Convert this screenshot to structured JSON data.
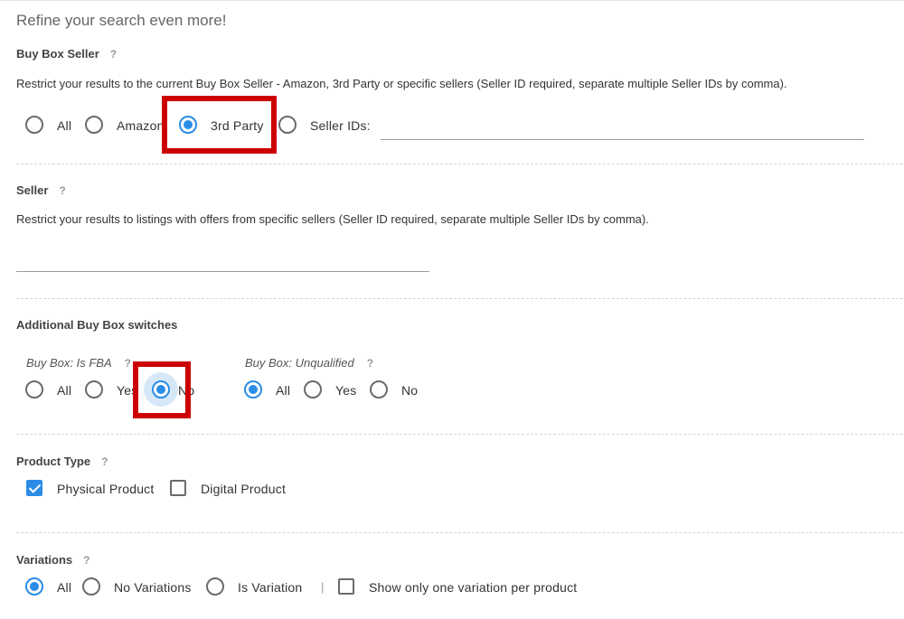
{
  "heading": "Refine your search even more!",
  "help_glyph": "?",
  "buy_box_seller": {
    "title": "Buy Box Seller",
    "description": "Restrict your results to the current Buy Box Seller - Amazon, 3rd Party or specific sellers (Seller ID required, separate multiple Seller IDs by comma).",
    "options": [
      "All",
      "Amazon",
      "3rd Party",
      "Seller IDs:"
    ],
    "selected": "3rd Party",
    "seller_ids_value": ""
  },
  "seller": {
    "title": "Seller",
    "description": "Restrict your results to listings with offers from specific sellers (Seller ID required, separate multiple Seller IDs by comma).",
    "input_value": ""
  },
  "additional": {
    "title": "Additional Buy Box switches",
    "is_fba": {
      "title": "Buy Box: Is FBA",
      "options": [
        "All",
        "Yes",
        "No"
      ],
      "selected": "No"
    },
    "unqualified": {
      "title": "Buy Box: Unqualified",
      "options": [
        "All",
        "Yes",
        "No"
      ],
      "selected": "All"
    }
  },
  "product_type": {
    "title": "Product Type",
    "options": [
      {
        "label": "Physical Product",
        "checked": true
      },
      {
        "label": "Digital Product",
        "checked": false
      }
    ]
  },
  "variations": {
    "title": "Variations",
    "options": [
      "All",
      "No Variations",
      "Is Variation"
    ],
    "selected": "All",
    "separator": "|",
    "one_per_product": {
      "label": "Show only one variation per product",
      "checked": false
    }
  },
  "colors": {
    "accent": "#2b8ce6",
    "highlight_box": "#cc0000"
  }
}
